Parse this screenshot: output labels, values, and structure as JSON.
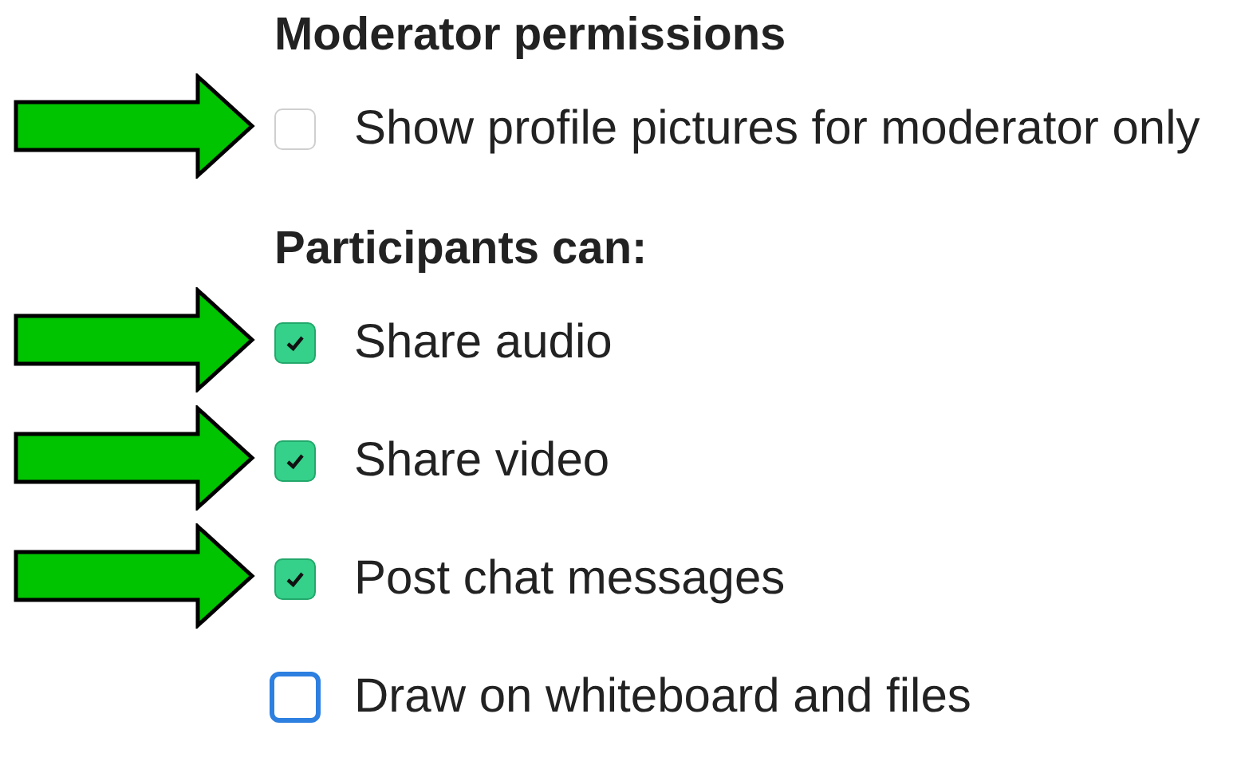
{
  "sections": [
    {
      "heading": "Moderator permissions",
      "items": [
        {
          "label": "Show profile pictures for moderator only",
          "checked": false,
          "focused": false,
          "arrow": true
        }
      ]
    },
    {
      "heading": "Participants can:",
      "items": [
        {
          "label": "Share audio",
          "checked": true,
          "focused": false,
          "arrow": true
        },
        {
          "label": "Share video",
          "checked": true,
          "focused": false,
          "arrow": true
        },
        {
          "label": "Post chat messages",
          "checked": true,
          "focused": false,
          "arrow": true
        },
        {
          "label": "Draw on whiteboard and files",
          "checked": false,
          "focused": true,
          "arrow": false
        }
      ]
    }
  ]
}
